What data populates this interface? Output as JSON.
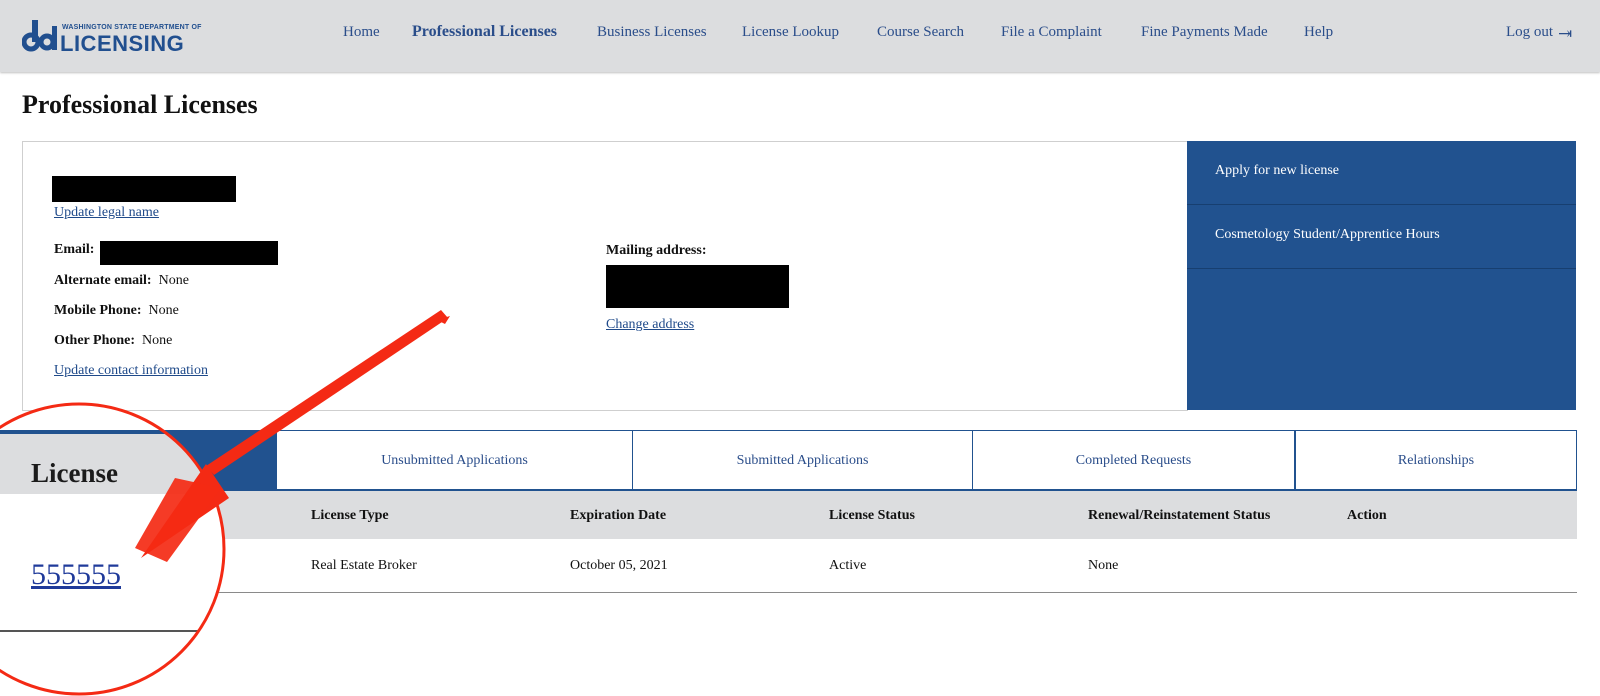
{
  "header": {
    "logo_dept": "WASHINGTON STATE DEPARTMENT OF",
    "logo_name": "LICENSING",
    "nav": [
      "Home",
      "Professional Licenses",
      "Business Licenses",
      "License Lookup",
      "Course Search",
      "File a Complaint",
      "Fine Payments Made",
      "Help"
    ],
    "logout": "Log out"
  },
  "page": {
    "title": "Professional Licenses"
  },
  "profile": {
    "update_name_link": "Update legal name",
    "email_label": "Email:",
    "alt_email_label": "Alternate email:",
    "alt_email_value": "None",
    "mobile_label": "Mobile Phone:",
    "mobile_value": "None",
    "other_label": "Other Phone:",
    "other_value": "None",
    "update_contact_link": "Update contact information",
    "mailing_label": "Mailing address:",
    "change_address_link": "Change address"
  },
  "side_menu": [
    "Apply for new license",
    "Cosmetology Student/Apprentice Hours"
  ],
  "tabs": [
    "License",
    "Unsubmitted Applications",
    "Submitted Applications",
    "Completed Requests",
    "Relationships"
  ],
  "table": {
    "headers": [
      "License",
      "License Type",
      "Expiration Date",
      "License Status",
      "Renewal/Reinstatement Status",
      "Action"
    ],
    "rows": [
      {
        "license": "555555",
        "type": "Real Estate Broker",
        "expiration": "October 05, 2021",
        "status": "Active",
        "renewal": "None",
        "action": ""
      }
    ]
  },
  "colors": {
    "brand_blue": "#21528f",
    "header_gray": "#dcdddf",
    "annotation_red": "#f42a14"
  }
}
